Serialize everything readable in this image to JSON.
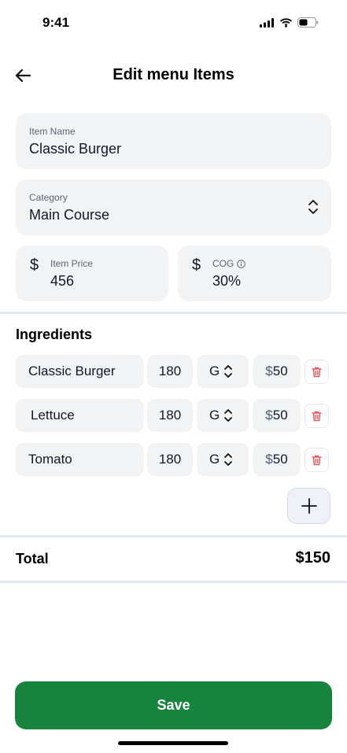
{
  "status_bar": {
    "time": "9:41"
  },
  "header": {
    "title": "Edit menu Items",
    "back_icon": "arrow-left-icon"
  },
  "form": {
    "item_name": {
      "label": "Item Name",
      "value": "Classic Burger"
    },
    "category": {
      "label": "Category",
      "value": "Main Course"
    },
    "item_price": {
      "symbol": "$",
      "label": "Item Price",
      "value": "456"
    },
    "cog": {
      "symbol": "$",
      "label": "COG",
      "value": "30%"
    }
  },
  "ingredients": {
    "title": "Ingredients",
    "rows": [
      {
        "name": "Classic Burger",
        "quantity": "180",
        "unit": "G",
        "currency": "$",
        "cost": "50"
      },
      {
        "name": "Lettuce",
        "quantity": "180",
        "unit": "G",
        "currency": "$",
        "cost": "50"
      },
      {
        "name": "Tomato",
        "quantity": "180",
        "unit": "G",
        "currency": "$",
        "cost": "50"
      }
    ]
  },
  "total": {
    "label": "Total",
    "value": "$150"
  },
  "actions": {
    "save_label": "Save"
  },
  "colors": {
    "primary": "#17843e",
    "field_bg": "#f2f3f5",
    "delete": "#e5484d"
  }
}
